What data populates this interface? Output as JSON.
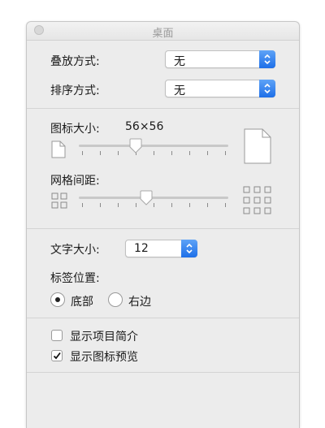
{
  "window": {
    "title": "桌面"
  },
  "arrange": {
    "label": "叠放方式:",
    "value": "无"
  },
  "sort": {
    "label": "排序方式:",
    "value": "无"
  },
  "icon_size": {
    "label": "图标大小:",
    "value_text": "56×56",
    "slider_fraction": 0.375,
    "tick_count": 9
  },
  "grid_spacing": {
    "label": "网格间距:",
    "slider_fraction": 0.45,
    "tick_count": 9
  },
  "text_size": {
    "label": "文字大小:",
    "value": "12"
  },
  "label_position": {
    "label": "标签位置:",
    "options": [
      {
        "label": "底部",
        "selected": true
      },
      {
        "label": "右边",
        "selected": false
      }
    ]
  },
  "options": {
    "show_item_info": {
      "label": "显示项目简介",
      "checked": false
    },
    "show_icon_preview": {
      "label": "显示图标预览",
      "checked": true
    }
  },
  "colors": {
    "accent": "#1e6fe8",
    "window_bg": "#ececec"
  }
}
